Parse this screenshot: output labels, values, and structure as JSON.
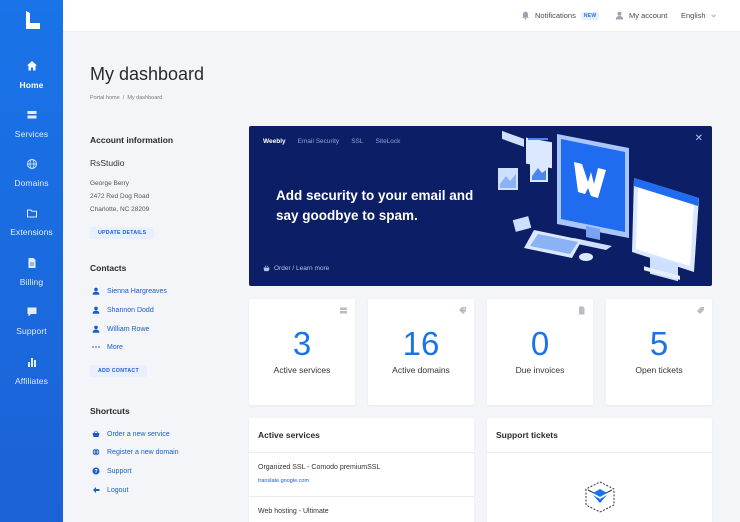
{
  "sidebar": {
    "logo_icon": "brand-logo-icon",
    "items": [
      {
        "label": "Home",
        "icon": "home-icon"
      },
      {
        "label": "Services",
        "icon": "server-icon"
      },
      {
        "label": "Domains",
        "icon": "globe-icon"
      },
      {
        "label": "Extensions",
        "icon": "folder-icon"
      },
      {
        "label": "Billing",
        "icon": "document-icon"
      },
      {
        "label": "Support",
        "icon": "chat-icon"
      },
      {
        "label": "Affiliates",
        "icon": "bar-chart-icon"
      }
    ]
  },
  "topbar": {
    "notifications_label": "Notifications",
    "new_badge": "NEW",
    "account_label": "My account",
    "language_label": "English"
  },
  "page": {
    "title": "My dashboard",
    "breadcrumb": [
      "Portal home",
      "My dashboard"
    ],
    "breadcrumb_sep": "/"
  },
  "account": {
    "title": "Account information",
    "company": "RsStudio",
    "address": [
      "George Berry",
      "2472 Red Dog Road",
      "Charlotte, NC 28209"
    ],
    "update_button": "UPDATE DETAILS"
  },
  "contacts": {
    "title": "Contacts",
    "items": [
      "Sienna Hargreaves",
      "Shannon Dodd",
      "William Rowe"
    ],
    "more_label": "More",
    "add_button": "ADD CONTACT"
  },
  "shortcuts": {
    "title": "Shortcuts",
    "items": [
      {
        "label": "Order a new service",
        "icon": "basket-icon"
      },
      {
        "label": "Register a new domain",
        "icon": "globe-icon"
      },
      {
        "label": "Support",
        "icon": "help-icon"
      },
      {
        "label": "Logout",
        "icon": "logout-icon"
      }
    ]
  },
  "banner": {
    "tabs": [
      "Weebly",
      "Email Security",
      "SSL",
      "SiteLock"
    ],
    "active_tab": "Weebly",
    "headline": "Add security to your email and say goodbye to spam.",
    "link_label": "Order / Learn more",
    "bg_color": "#0b1e66"
  },
  "stats": [
    {
      "value": "3",
      "label": "Active services",
      "icon": "server-icon"
    },
    {
      "value": "16",
      "label": "Active domains",
      "icon": "tag-icon"
    },
    {
      "value": "0",
      "label": "Due invoices",
      "icon": "document-icon"
    },
    {
      "value": "5",
      "label": "Open tickets",
      "icon": "ticket-icon"
    }
  ],
  "active_services": {
    "title": "Active services",
    "items": [
      {
        "name": "Organized SSL - Comodo premiumSSL",
        "url": "translate.google.com"
      },
      {
        "name": "Web hosting - Ultimate",
        "url": ""
      }
    ]
  },
  "support_tickets": {
    "title": "Support tickets",
    "empty_icon": "empty-box-icon"
  },
  "colors": {
    "accent": "#1a73e8",
    "sidebar": "#1b66dc",
    "background": "#f4f5f8"
  }
}
